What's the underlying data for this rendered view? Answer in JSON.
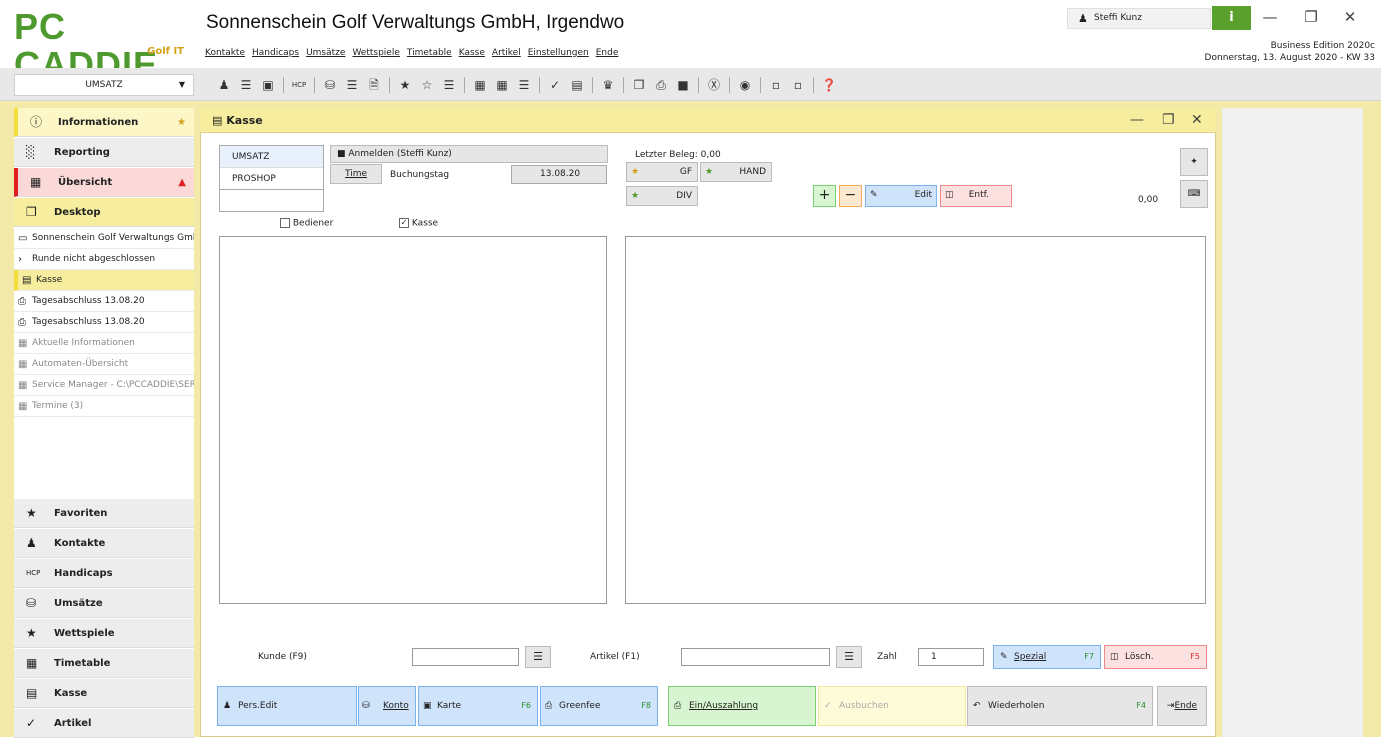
{
  "app": {
    "logo": "PC CADDIE",
    "logo_sub": "Golf IT",
    "title": "Sonnenschein Golf Verwaltungs GmbH, Irgendwo",
    "menu": [
      "Kontakte",
      "Handicaps",
      "Umsätze",
      "Wettspiele",
      "Timetable",
      "Kasse",
      "Artikel",
      "Einstellungen",
      "Ende"
    ],
    "user": "Steffi Kunz",
    "info_btn": "i",
    "edition": "Business Edition 2020c",
    "date": "Donnerstag, 13. August 2020 - KW 33"
  },
  "toolbar": {
    "mode": "UMSATZ"
  },
  "sidebar": {
    "informationen": "Informationen",
    "reporting": "Reporting",
    "uebersicht": "Übersicht",
    "desktop": "Desktop",
    "desktop_items": [
      "Sonnenschein Golf Verwaltungs GmbH",
      "Runde nicht abgeschlossen",
      "Kasse",
      "Tagesabschluss 13.08.20",
      "Tagesabschluss 13.08.20",
      "Aktuelle Informationen",
      "Automaten-Übersicht",
      "Service Manager - C:\\PCCADDIE\\SERVICE",
      "Termine (3)"
    ],
    "bottom": [
      "Favoriten",
      "Kontakte",
      "Handicaps",
      "Umsätze",
      "Wettspiele",
      "Timetable",
      "Kasse",
      "Artikel"
    ]
  },
  "window": {
    "title": "Kasse"
  },
  "kasse": {
    "tabs": [
      "UMSATZ",
      "PROSHOP"
    ],
    "login": "Anmelden (Steffi Kunz)",
    "time_btn": "Time",
    "buchungstag_label": "Buchungstag",
    "buchungstag": "13.08.20",
    "bediener": "Bediener",
    "kasse_cb": "Kasse",
    "letzter_beleg": "Letzter Beleg: 0,00",
    "gf": "GF",
    "hand": "HAND",
    "div": "DIV",
    "edit": "Edit",
    "entf": "Entf.",
    "total": "0,00",
    "kunde_label": "Kunde (F9)",
    "artikel_label": "Artikel (F1)",
    "zahl_label": "Zahl",
    "zahl_value": "1",
    "spezial": "Spezial",
    "spezial_key": "F7",
    "loesch": "Lösch.",
    "loesch_key": "F5",
    "pers_edit": "Pers.Edit",
    "konto": "Konto",
    "karte": "Karte",
    "karte_key": "F6",
    "greenfee": "Greenfee",
    "greenfee_key": "F8",
    "einauszahlung": "Ein/Auszahlung",
    "ausbuchen": "Ausbuchen",
    "wiederholen": "Wiederholen",
    "wiederholen_key": "F4",
    "ende": "Ende"
  },
  "colors": {
    "brand": "#4f9a2e",
    "window_title": "#f6ee9e",
    "blue_btn": "#cfe3fb",
    "green_btn": "#d6f5d0",
    "red_btn": "#fde0e0",
    "yellow_btn": "#fefbd8"
  }
}
